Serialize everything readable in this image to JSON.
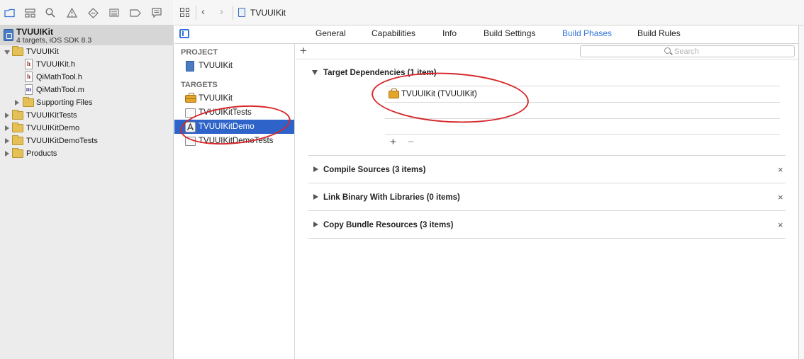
{
  "navigator": {
    "toolbar_icons": [
      "folder-icon",
      "hierarchy-icon",
      "search-icon",
      "warning-icon",
      "test-diamond-icon",
      "debug-list-icon",
      "breakpoint-icon",
      "log-icon"
    ],
    "project": {
      "name": "TVUUIKit",
      "subtitle": "4 targets, iOS SDK 8.3"
    },
    "tree": [
      {
        "label": "TVUUIKit",
        "type": "folder",
        "open": true
      },
      {
        "label": "TVUUIKit.h",
        "type": "h"
      },
      {
        "label": "QiMathTool.h",
        "type": "h"
      },
      {
        "label": "QiMathTool.m",
        "type": "m"
      },
      {
        "label": "Supporting Files",
        "type": "folder",
        "open": false
      },
      {
        "label": "TVUUIKitTests",
        "type": "folder",
        "open": false
      },
      {
        "label": "TVUUIKitDemo",
        "type": "folder",
        "open": false
      },
      {
        "label": "TVUUIKitDemoTests",
        "type": "folder",
        "open": false
      },
      {
        "label": "Products",
        "type": "folder",
        "open": false
      }
    ],
    "file_glyphs": {
      "h": "h",
      "m": "m"
    }
  },
  "jump_bar": {
    "back_glyph": "‹",
    "forward_glyph": "›",
    "title": "TVUUIKit"
  },
  "tabs": {
    "items": [
      "General",
      "Capabilities",
      "Info",
      "Build Settings",
      "Build Phases",
      "Build Rules"
    ],
    "active": "Build Phases"
  },
  "target_list": {
    "project_header": "PROJECT",
    "project_item": "TVUUIKit",
    "targets_header": "TARGETS",
    "targets": [
      "TVUUIKit",
      "TVUUIKitTests",
      "TVUUIKitDemo",
      "TVUUIKitDemoTests"
    ],
    "selected": "TVUUIKitDemo"
  },
  "phases": {
    "add_glyph": "+",
    "search_placeholder": "Search",
    "target_dependencies": {
      "title": "Target Dependencies (1 item)",
      "items": [
        "TVUUIKit (TVUUIKit)"
      ],
      "add_glyph": "+",
      "remove_glyph": "−"
    },
    "collapsed": [
      {
        "title": "Compile Sources (3 items)"
      },
      {
        "title": "Link Binary With Libraries (0 items)"
      },
      {
        "title": "Copy Bundle Resources (3 items)"
      }
    ],
    "close_glyph": "×"
  },
  "colors": {
    "accent": "#3174d8",
    "selection": "#2e63c9",
    "annotation": "#d7262a"
  }
}
